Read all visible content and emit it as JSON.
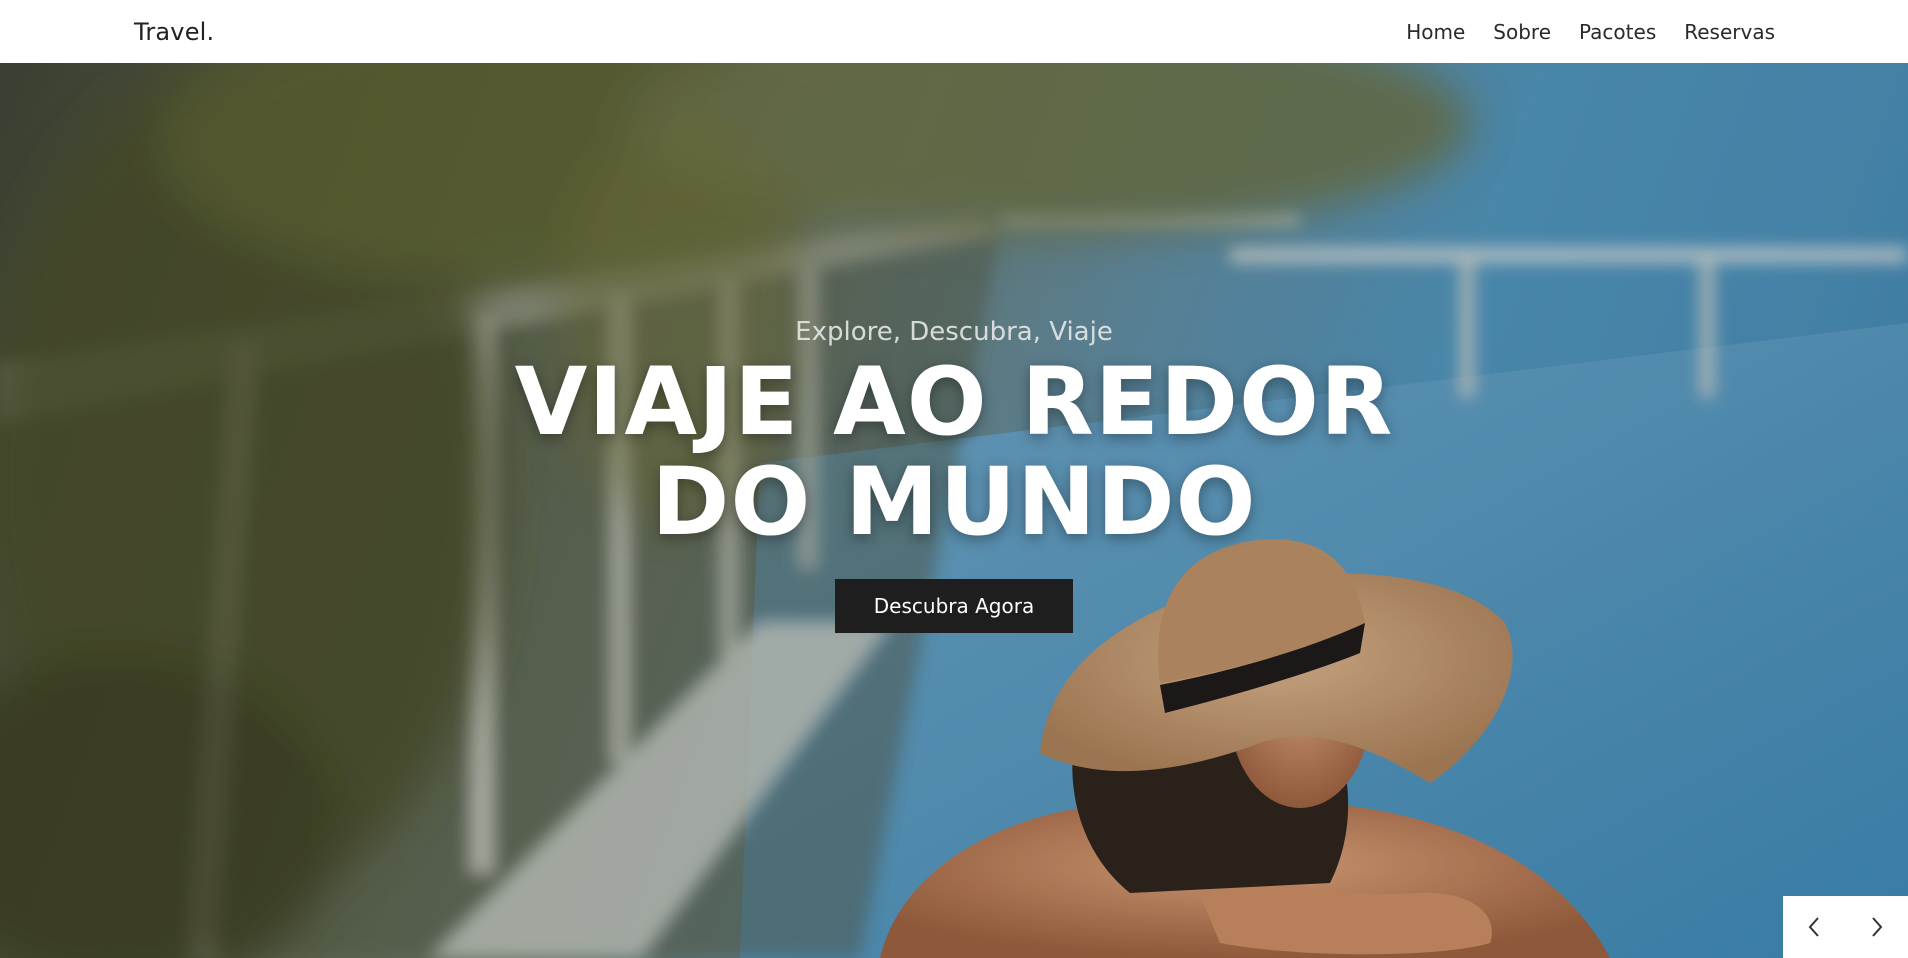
{
  "navbar": {
    "brand": "Travel.",
    "links": [
      "Home",
      "Sobre",
      "Pacotes",
      "Reservas"
    ]
  },
  "hero": {
    "eyebrow": "Explore, Descubra, Viaje",
    "title": "VIAJE AO REDOR DO MUNDO",
    "cta": "Descubra Agora"
  },
  "slider": {
    "prev_icon": "chevron-left-icon",
    "next_icon": "chevron-right-icon"
  },
  "colors": {
    "cta_background": "#1e1e1e",
    "nav_background": "#ffffff",
    "pool_blue": "#4a8cb4"
  }
}
